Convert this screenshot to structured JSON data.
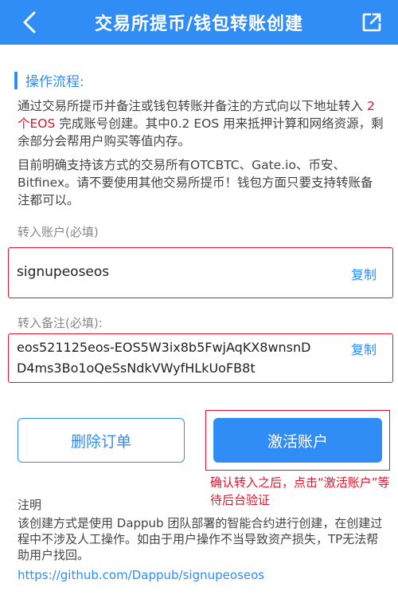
{
  "header": {
    "title": "交易所提币/钱包转账创建",
    "bg_color": "#2f8df5"
  },
  "section": {
    "title": "操作流程:"
  },
  "intro": {
    "before": "通过交易所提币并备注或钱包转账并备注的方式向以下地址转入 ",
    "highlight": "2个EOS",
    "after": " 完成账号创建。其中0.2 EOS 用来抵押计算和网络资源，剩余部分会帮用户购买等值内存。"
  },
  "support_text": "目前明确支持该方式的交易所有OTCBTC、Gate.io、币安、Bitfinex。请不要使用其他交易所提币！钱包方面只要支持转账备注都可以。",
  "account": {
    "label": "转入账户(必填)",
    "value": "signupeoseos",
    "copy_label": "复制"
  },
  "memo": {
    "label": "转入备注(必填):",
    "line1": "eos521125eos-EOS5W3ix8b5FwjAqKX8wnsnD",
    "line2": "D4ms3Bo1oQeSsNdkVWyfHLkUoFB8t",
    "copy_label": "复制"
  },
  "buttons": {
    "delete_label": "删除订单",
    "activate_label": "激活账户"
  },
  "annotation": "确认转入之后，点击“激活账户”等待后台验证",
  "note": {
    "title": "注明",
    "body": "该创建方式是使用 Dappub 团队部署的智能合约进行创建，在创建过程中不涉及人工操作。如由于用户操作不当导致资产损失，TP无法帮助用户找回。",
    "link": "https://github.com/Dappub/signupeoseos"
  },
  "colors": {
    "accent": "#2f8df5",
    "highlight_red": "#e0142a"
  }
}
